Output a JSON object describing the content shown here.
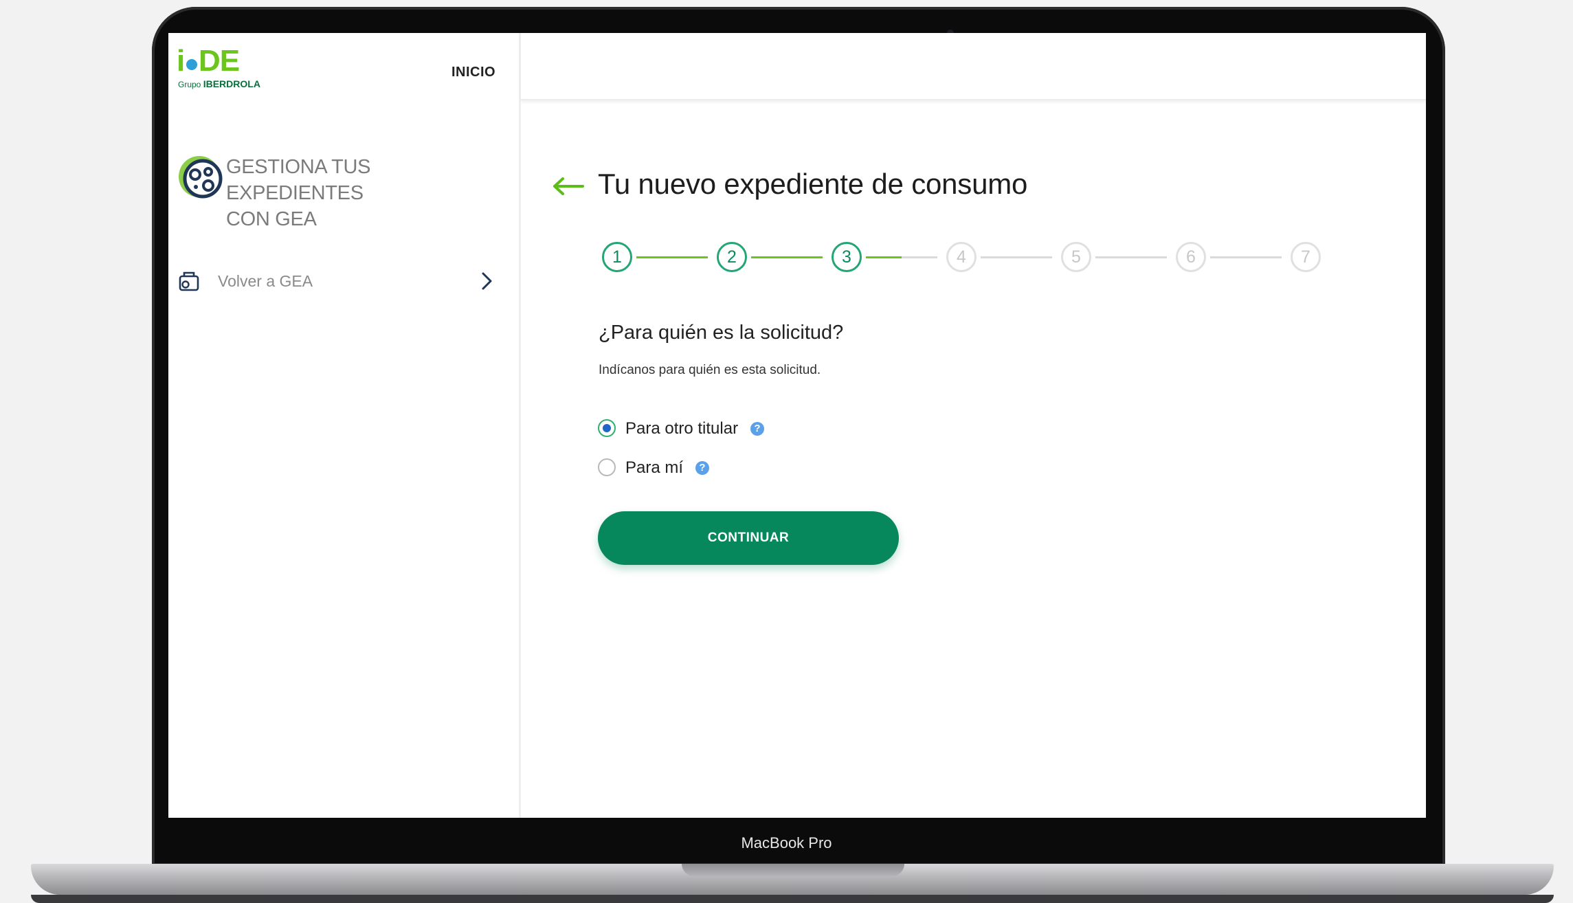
{
  "device": {
    "label": "MacBook Pro"
  },
  "sidebar": {
    "logo": {
      "mark": "i",
      "name": "DE",
      "group_prefix": "Grupo",
      "group_name": "IBERDROLA"
    },
    "nav_inicio": "INICIO",
    "section_title_line1": "GESTIONA TUS EXPEDIENTES",
    "section_title_line2": "CON GEA",
    "section_icon": "gea-logo-icon",
    "back_link": {
      "label": "Volver a GEA",
      "icon": "document-cart-icon",
      "chevron": "chevron-right-icon"
    }
  },
  "main": {
    "back_icon": "arrow-left-icon",
    "title": "Tu nuevo expediente de consumo",
    "stepper": {
      "current_step": 3,
      "steps": [
        "1",
        "2",
        "3",
        "4",
        "5",
        "6",
        "7"
      ]
    },
    "question": "¿Para quién es la solicitud?",
    "hint": "Indícanos para quién es esta solicitud.",
    "options": [
      {
        "label": "Para otro titular",
        "selected": true,
        "help_icon": "question-mark-icon",
        "help_glyph": "?"
      },
      {
        "label": "Para mí",
        "selected": false,
        "help_icon": "question-mark-icon",
        "help_glyph": "?"
      }
    ],
    "continue_label": "CONTINUAR"
  },
  "colors": {
    "brand_green": "#6cc51c",
    "primary_button": "#06875c",
    "step_done": "#23a575",
    "help_blue": "#5aa1ea"
  }
}
